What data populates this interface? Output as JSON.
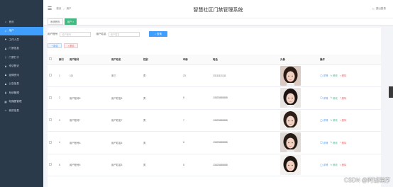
{
  "sidebar": {
    "items": [
      {
        "label": "首页",
        "icon": "home-icon",
        "active": false
      },
      {
        "label": "用户",
        "icon": "user-icon",
        "active": true
      },
      {
        "label": "工作人员",
        "icon": "flag-icon",
        "active": false
      },
      {
        "label": "门禁信息",
        "icon": "person-icon",
        "active": false
      },
      {
        "label": "门禁打卡",
        "icon": "door-icon",
        "active": false
      },
      {
        "label": "来访登记",
        "icon": "person-icon",
        "active": false
      },
      {
        "label": "疫情资讯",
        "icon": "person-icon",
        "active": false
      },
      {
        "label": "公告信息",
        "icon": "person-icon",
        "active": false
      },
      {
        "label": "系统管理",
        "icon": "person-icon",
        "active": false
      },
      {
        "label": "轮播图管理",
        "icon": "grid-icon",
        "active": false
      },
      {
        "label": "我的信息",
        "icon": "user-icon",
        "active": false
      }
    ]
  },
  "header": {
    "breadcrumb": [
      "首页",
      "用户"
    ],
    "title": "智慧社区门禁管理系统",
    "logout": "退出登录"
  },
  "tags": [
    {
      "label": "系统首页",
      "active": false
    },
    {
      "label": "用户 ×",
      "active": true
    }
  ],
  "search": {
    "field1_label": "用户账号",
    "field1_placeholder": "用户账号",
    "field2_label": "用户姓名",
    "field2_placeholder": "用户姓名",
    "button": "查询"
  },
  "actions": {
    "add": "+ 新增",
    "delete": "× 删除"
  },
  "table": {
    "columns": [
      "",
      "索引",
      "用户账号",
      "用户姓名",
      "性别",
      "年龄",
      "电话",
      "头像",
      "操作"
    ],
    "rows": [
      {
        "index": "1",
        "account": "111",
        "name": "张三",
        "gender": "男",
        "age": "23",
        "phone": "13111111111"
      },
      {
        "index": "2",
        "account": "用户账号8",
        "name": "用户姓名8",
        "gender": "男",
        "age": "8",
        "phone": "13823888888"
      },
      {
        "index": "3",
        "account": "用户账号7",
        "name": "用户姓名7",
        "gender": "男",
        "age": "7",
        "phone": "13823888888"
      },
      {
        "index": "4",
        "account": "用户账号6",
        "name": "用户姓名6",
        "gender": "男",
        "age": "6",
        "phone": "13823888888"
      },
      {
        "index": "5",
        "account": "用户账号5",
        "name": "用户姓名5",
        "gender": "男",
        "age": "5",
        "phone": "13823888888"
      }
    ],
    "ops": {
      "detail": "详情",
      "edit": "修改",
      "delete": "删除"
    }
  },
  "watermark": "CSDN @阿诚程序",
  "colors": {
    "sidebar": "#2b3a4b",
    "accent": "#409eff",
    "active_tag": "#42b983",
    "danger": "#f56c6c"
  }
}
